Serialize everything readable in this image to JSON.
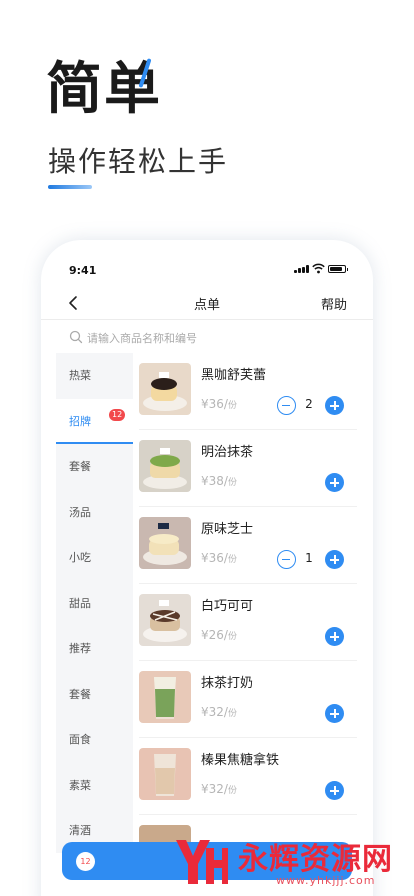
{
  "hero": {
    "title": "简单",
    "subtitle": "操作轻松上手"
  },
  "status_bar": {
    "time": "9:41"
  },
  "nav": {
    "title": "点单",
    "help": "帮助"
  },
  "search": {
    "placeholder": "请输入商品名称和编号"
  },
  "categories": [
    {
      "label": "热菜"
    },
    {
      "label": "招牌",
      "badge": "12",
      "active": true
    },
    {
      "label": "套餐"
    },
    {
      "label": "汤品"
    },
    {
      "label": "小吃"
    },
    {
      "label": "甜品"
    },
    {
      "label": "推荐"
    },
    {
      "label": "套餐"
    },
    {
      "label": "面食"
    },
    {
      "label": "素菜"
    },
    {
      "label": "清酒"
    }
  ],
  "products": [
    {
      "name": "黑咖舒芙蕾",
      "price": "¥36/",
      "unit": "份",
      "qty": "2",
      "has_qty": true
    },
    {
      "name": "明治抹茶",
      "price": "¥38/",
      "unit": "份",
      "has_qty": false
    },
    {
      "name": "原味芝士",
      "price": "¥36/",
      "unit": "份",
      "qty": "1",
      "has_qty": true
    },
    {
      "name": "白巧可可",
      "price": "¥26/",
      "unit": "份",
      "has_qty": false
    },
    {
      "name": "抹茶打奶",
      "price": "¥32/",
      "unit": "份",
      "has_qty": false
    },
    {
      "name": "榛果焦糖拿铁",
      "price": "¥32/",
      "unit": "份",
      "has_qty": false
    }
  ],
  "cart": {
    "badge": "12"
  },
  "watermark": {
    "name": "永辉资源网",
    "url": "www.yhkjjj.com"
  },
  "colors": {
    "accent": "#2f8cf2",
    "badge": "#f2494c",
    "watermark": "#ea2a3a"
  }
}
